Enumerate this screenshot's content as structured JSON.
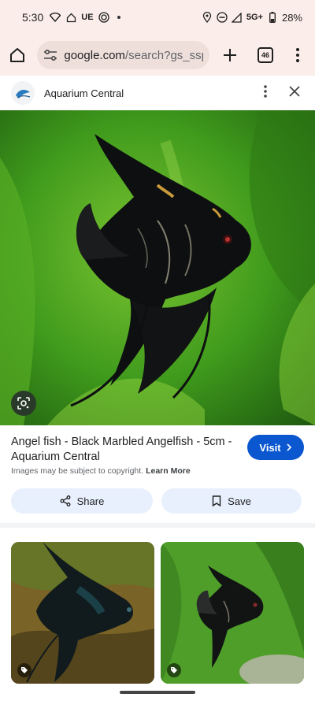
{
  "status_bar": {
    "time": "5:30",
    "carrier_badge": "UE",
    "network": "5G+",
    "battery": "28%",
    "icons": [
      "wifi-icon",
      "home-icon",
      "hotspot-icon",
      "location-icon",
      "dnd-icon",
      "signal-icon",
      "battery-icon"
    ]
  },
  "toolbar": {
    "url_domain": "google.com",
    "url_path": "/search?gs_ssp=e",
    "tab_count": "46"
  },
  "site": {
    "name": "Aquarium Central"
  },
  "result": {
    "title": "Angel fish - Black Marbled Angelfish - 5cm - Aquarium Central",
    "visit_label": "Visit",
    "copyright_text": "Images may be subject to copyright.",
    "learn_more_label": "Learn More",
    "share_label": "Share",
    "save_label": "Save"
  },
  "colors": {
    "accent_blue": "#0b57d0",
    "chrome_bg": "#fbeeea",
    "pill_bg": "#e8f0fe"
  }
}
